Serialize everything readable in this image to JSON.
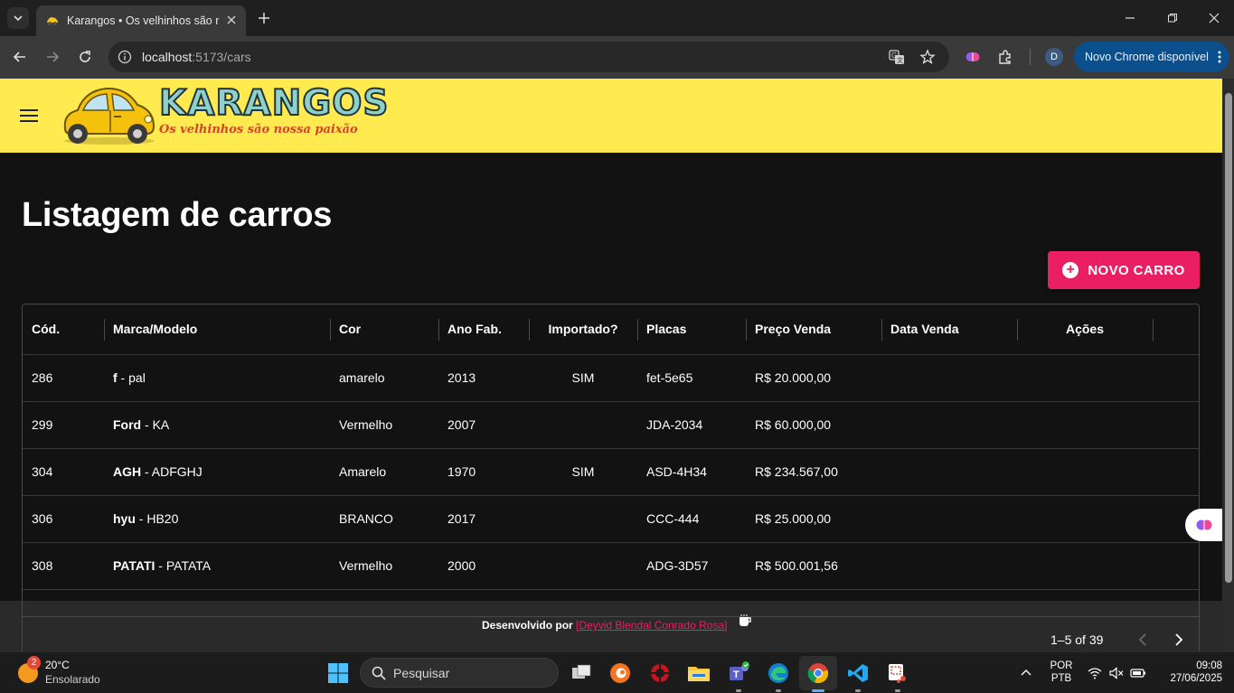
{
  "browser": {
    "tab_title": "Karangos • Os velhinhos são no",
    "url_host": "localhost",
    "url_rest": ":5173/cars",
    "update_label": "Novo Chrome disponível",
    "profile_initial": "D"
  },
  "app": {
    "logo_title": "KARANGOS",
    "logo_subtitle": "Os velhinhos são nossa paixão",
    "page_title": "Listagem de carros",
    "new_button_label": "NOVO CARRO",
    "accent_color": "#e91e63",
    "header_color": "#ffeb4f"
  },
  "table": {
    "columns": [
      "Cód.",
      "Marca/Modelo",
      "Cor",
      "Ano Fab.",
      "Importado?",
      "Placas",
      "Preço Venda",
      "Data Venda",
      "Ações"
    ],
    "rows": [
      {
        "id": "286",
        "brand": "f",
        "model": "pal",
        "color": "amarelo",
        "year": "2013",
        "imported": "SIM",
        "plate": "fet-5e65",
        "price": "R$ 20.000,00",
        "sale_date": ""
      },
      {
        "id": "299",
        "brand": "Ford",
        "model": "KA",
        "color": "Vermelho",
        "year": "2007",
        "imported": "",
        "plate": "JDA-2034",
        "price": "R$ 60.000,00",
        "sale_date": ""
      },
      {
        "id": "304",
        "brand": "AGH",
        "model": "ADFGHJ",
        "color": "Amarelo",
        "year": "1970",
        "imported": "SIM",
        "plate": "ASD-4H34",
        "price": "R$ 234.567,00",
        "sale_date": ""
      },
      {
        "id": "306",
        "brand": "hyu",
        "model": "HB20",
        "color": "BRANCO",
        "year": "2017",
        "imported": "",
        "plate": "CCC-444",
        "price": "R$ 25.000,00",
        "sale_date": ""
      },
      {
        "id": "308",
        "brand": "PATATI",
        "model": "PATATA",
        "color": "Vermelho",
        "year": "2000",
        "imported": "",
        "plate": "ADG-3D57",
        "price": "R$ 500.001,56",
        "sale_date": ""
      }
    ],
    "pagination": "1–5 of 39"
  },
  "footer": {
    "credit_prefix": "Desenvolvido por",
    "credit_link": "[Deyvid Blendal Conrado Rosa]"
  },
  "taskbar": {
    "weather_badge": "2",
    "weather_temp": "20°C",
    "weather_cond": "Ensolarado",
    "search_label": "Pesquisar",
    "lang_top": "POR",
    "lang_bottom": "PTB",
    "time": "09:08",
    "date": "27/06/2025"
  }
}
